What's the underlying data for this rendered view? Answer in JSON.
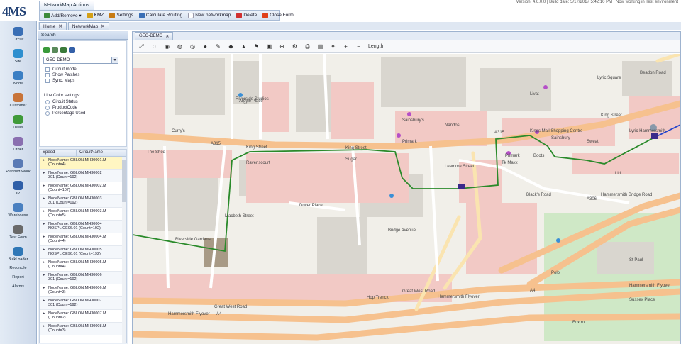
{
  "app": {
    "logo": "4MS",
    "version": "Version: 4.6.0.0 | Build date: 5/17/2017 5:42:10 PM | Now working in Test environment"
  },
  "ribbon": {
    "tab": "NetworkMap Actions",
    "items": [
      {
        "label": "Add/Remove ▾",
        "icon": "add-remove-icon",
        "color": "#3c8a3a"
      },
      {
        "label": "KMZ",
        "icon": "kmz-icon",
        "color": "#d4a017"
      },
      {
        "label": "Settings",
        "icon": "settings-icon",
        "color": "#c77a12"
      },
      {
        "label": "Calculate Routing",
        "icon": "routing-icon",
        "color": "#3a6fb5"
      },
      {
        "label": "New networkmap",
        "icon": "new-map-icon",
        "color": "#ffffff"
      },
      {
        "label": "Delete",
        "icon": "delete-icon",
        "color": "#d03030"
      },
      {
        "label": "Close Form",
        "icon": "close-form-icon",
        "color": "#e0401a"
      }
    ]
  },
  "left_nav": [
    {
      "label": "Circuit",
      "icon": "circuit-icon"
    },
    {
      "label": "Site",
      "icon": "site-icon"
    },
    {
      "label": "Node",
      "icon": "node-icon"
    },
    {
      "label": "Customer",
      "icon": "customer-icon"
    },
    {
      "label": "Users",
      "icon": "users-icon"
    },
    {
      "label": "Order",
      "icon": "order-icon"
    },
    {
      "label": "Planned Work",
      "icon": "planned-work-icon"
    },
    {
      "label": "IP",
      "icon": "ip-icon"
    },
    {
      "label": "Warehouse",
      "icon": "warehouse-icon"
    },
    {
      "label": "Test Form",
      "icon": "test-form-icon"
    },
    {
      "label": "BulkLoader",
      "icon": "bulkloader-icon"
    }
  ],
  "left_nav_text": [
    "Reconcile",
    "Report",
    "Alarms"
  ],
  "main_tabs": [
    {
      "label": "Home"
    },
    {
      "label": "NetworkMap"
    }
  ],
  "search_panel": {
    "title": "Search",
    "selected_map": "GEO-DEMO",
    "options": [
      {
        "label": "Circuit mode"
      },
      {
        "label": "Show Patches"
      },
      {
        "label": "Sync. Maps"
      }
    ],
    "line_color_title": "Line Color settings:",
    "line_color_options": [
      {
        "label": "Circuit Status"
      },
      {
        "label": "ProductCode"
      },
      {
        "label": "Percentage Used"
      }
    ]
  },
  "grid": {
    "columns": [
      "Speed",
      "CircuitName"
    ],
    "rows": [
      [
        "NodeName: GBLON.MH30001.M",
        "(Count=4)"
      ],
      [
        "NodeName: GBLON.MH30002",
        "301 (Count=192)"
      ],
      [
        "NodeName: GBLON.MH30002.M",
        "(Count=107)"
      ],
      [
        "NodeName: GBLON.MH30003",
        "301 (Count=192)"
      ],
      [
        "NodeName: GBLON.MH30003.M",
        "(Count=5)"
      ],
      [
        "NodeName: GBLON.MH30004",
        "NOSPLICE96.01 (Count=192)"
      ],
      [
        "NodeName: GBLON.MH30004.M",
        "(Count=4)"
      ],
      [
        "NodeName: GBLON.MH30005",
        "NOSPLICE96.01 (Count=192)"
      ],
      [
        "NodeName: GBLON.MH30005.M",
        "(Count=4)"
      ],
      [
        "NodeName: GBLON.MH30006",
        "301 (Count=192)"
      ],
      [
        "NodeName: GBLON.MH30006.M",
        "(Count=3)"
      ],
      [
        "NodeName: GBLON.MH30007",
        "301 (Count=192)"
      ],
      [
        "NodeName: GBLON.MH30007.M",
        "(Count=2)"
      ],
      [
        "NodeName: GBLON.MH30008.M",
        "(Count=3)"
      ]
    ]
  },
  "map": {
    "tab": "GEO-DEMO",
    "length_label": "Length:",
    "streets": [
      "King Street",
      "King Street",
      "King Street",
      "A315",
      "A315",
      "Argyle Place",
      "Black's Road",
      "Hammersmith Bridge Road",
      "Riverside Gardens",
      "Great West Road",
      "Great West Road",
      "Hammersmith Flyover",
      "Hammersmith Flyover",
      "Hammersmith Flyover",
      "A4",
      "A4",
      "A306",
      "Dover Place",
      "Beadon Road",
      "Lyric Square",
      "Sussex Place",
      "Macbeth Street",
      "Bridge Avenue",
      "Leamore Street"
    ],
    "places": [
      "Sugar",
      "Primark",
      "Curry's",
      "Tk Maxx",
      "Boots",
      "Lyric Hammersmith",
      "Riverside Studios",
      "Livat",
      "Nandos",
      "Lidl",
      "St Paul",
      "Sainsbury's",
      "Kings Mall Shopping Centre",
      "Primark",
      "Sainsbury",
      "Sweat",
      "The Shed",
      "Ravenscourt",
      "Hop Trenck",
      "Polo",
      "Foxtrot"
    ]
  }
}
